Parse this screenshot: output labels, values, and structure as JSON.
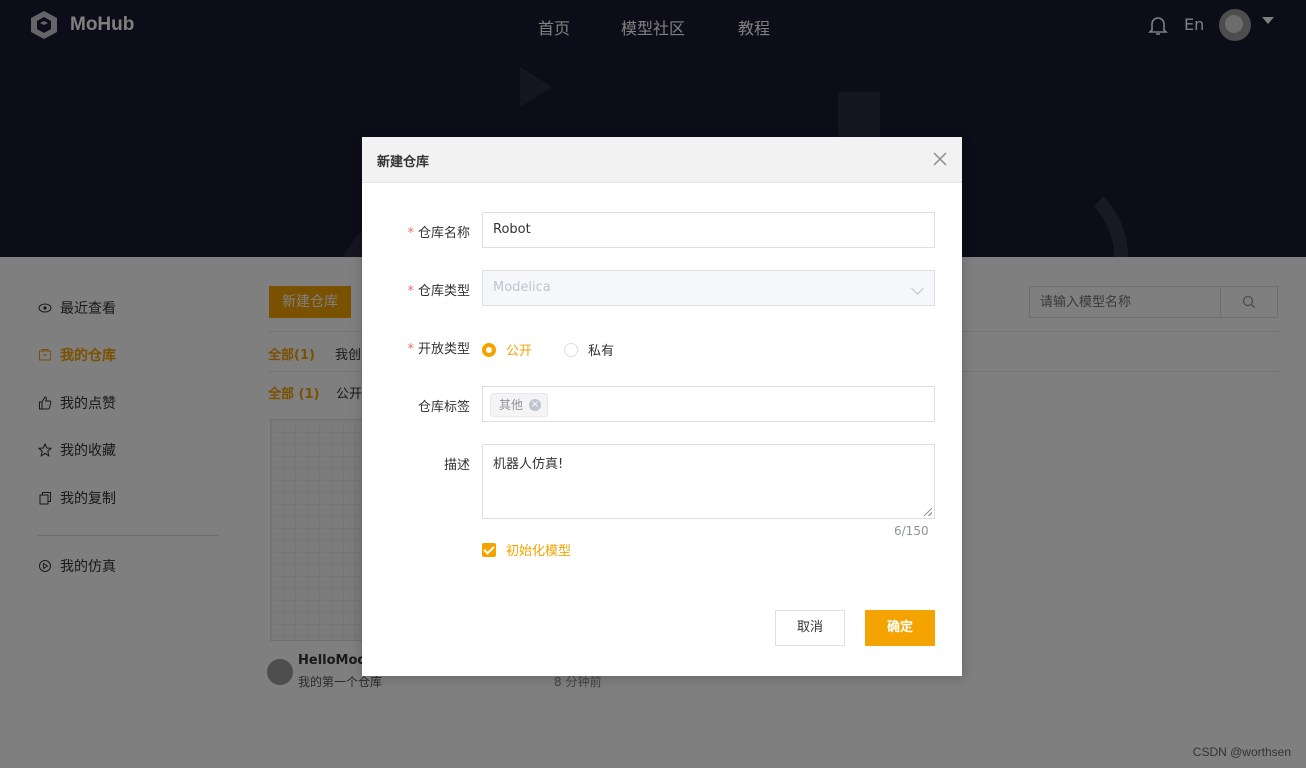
{
  "header": {
    "logo_text": "MoHub",
    "nav": [
      "首页",
      "模型社区",
      "教程"
    ],
    "lang": "En"
  },
  "sidebar": {
    "items": [
      {
        "label": "最近查看",
        "icon": "eye-icon",
        "active": false
      },
      {
        "label": "我的仓库",
        "icon": "repository-icon",
        "active": true
      },
      {
        "label": "我的点赞",
        "icon": "thumbs-up-icon",
        "active": false
      },
      {
        "label": "我的收藏",
        "icon": "star-icon",
        "active": false
      },
      {
        "label": "我的复制",
        "icon": "copy-icon",
        "active": false
      },
      {
        "label": "我的仿真",
        "icon": "play-circle-icon",
        "active": false
      }
    ]
  },
  "main": {
    "new_repo_button": "新建仓库",
    "search_placeholder": "请输入模型名称",
    "tabs_row1": [
      "全部(1)",
      "我创"
    ],
    "tabs_row2": [
      "全部 (1)",
      "公开"
    ],
    "repo": {
      "name": "HelloMod",
      "desc": "我的第一个仓库",
      "time": "8 分钟前"
    }
  },
  "dialog": {
    "title": "新建仓库",
    "fields": {
      "name_label": "仓库名称",
      "name_value": "Robot",
      "type_label": "仓库类型",
      "type_value": "Modelica",
      "open_label": "开放类型",
      "open_options": [
        "公开",
        "私有"
      ],
      "open_selected": "公开",
      "tags_label": "仓库标签",
      "tags": [
        "其他"
      ],
      "desc_label": "描述",
      "desc_value": "机器人仿真!",
      "desc_count": "6/150",
      "init_model_label": "初始化模型",
      "init_model_checked": true
    },
    "cancel_label": "取消",
    "confirm_label": "确定"
  },
  "watermark": "CSDN @worthsen",
  "colors": {
    "accent": "#f5a300",
    "header_bg": "#1a1a33",
    "required": "#f56c6c"
  }
}
